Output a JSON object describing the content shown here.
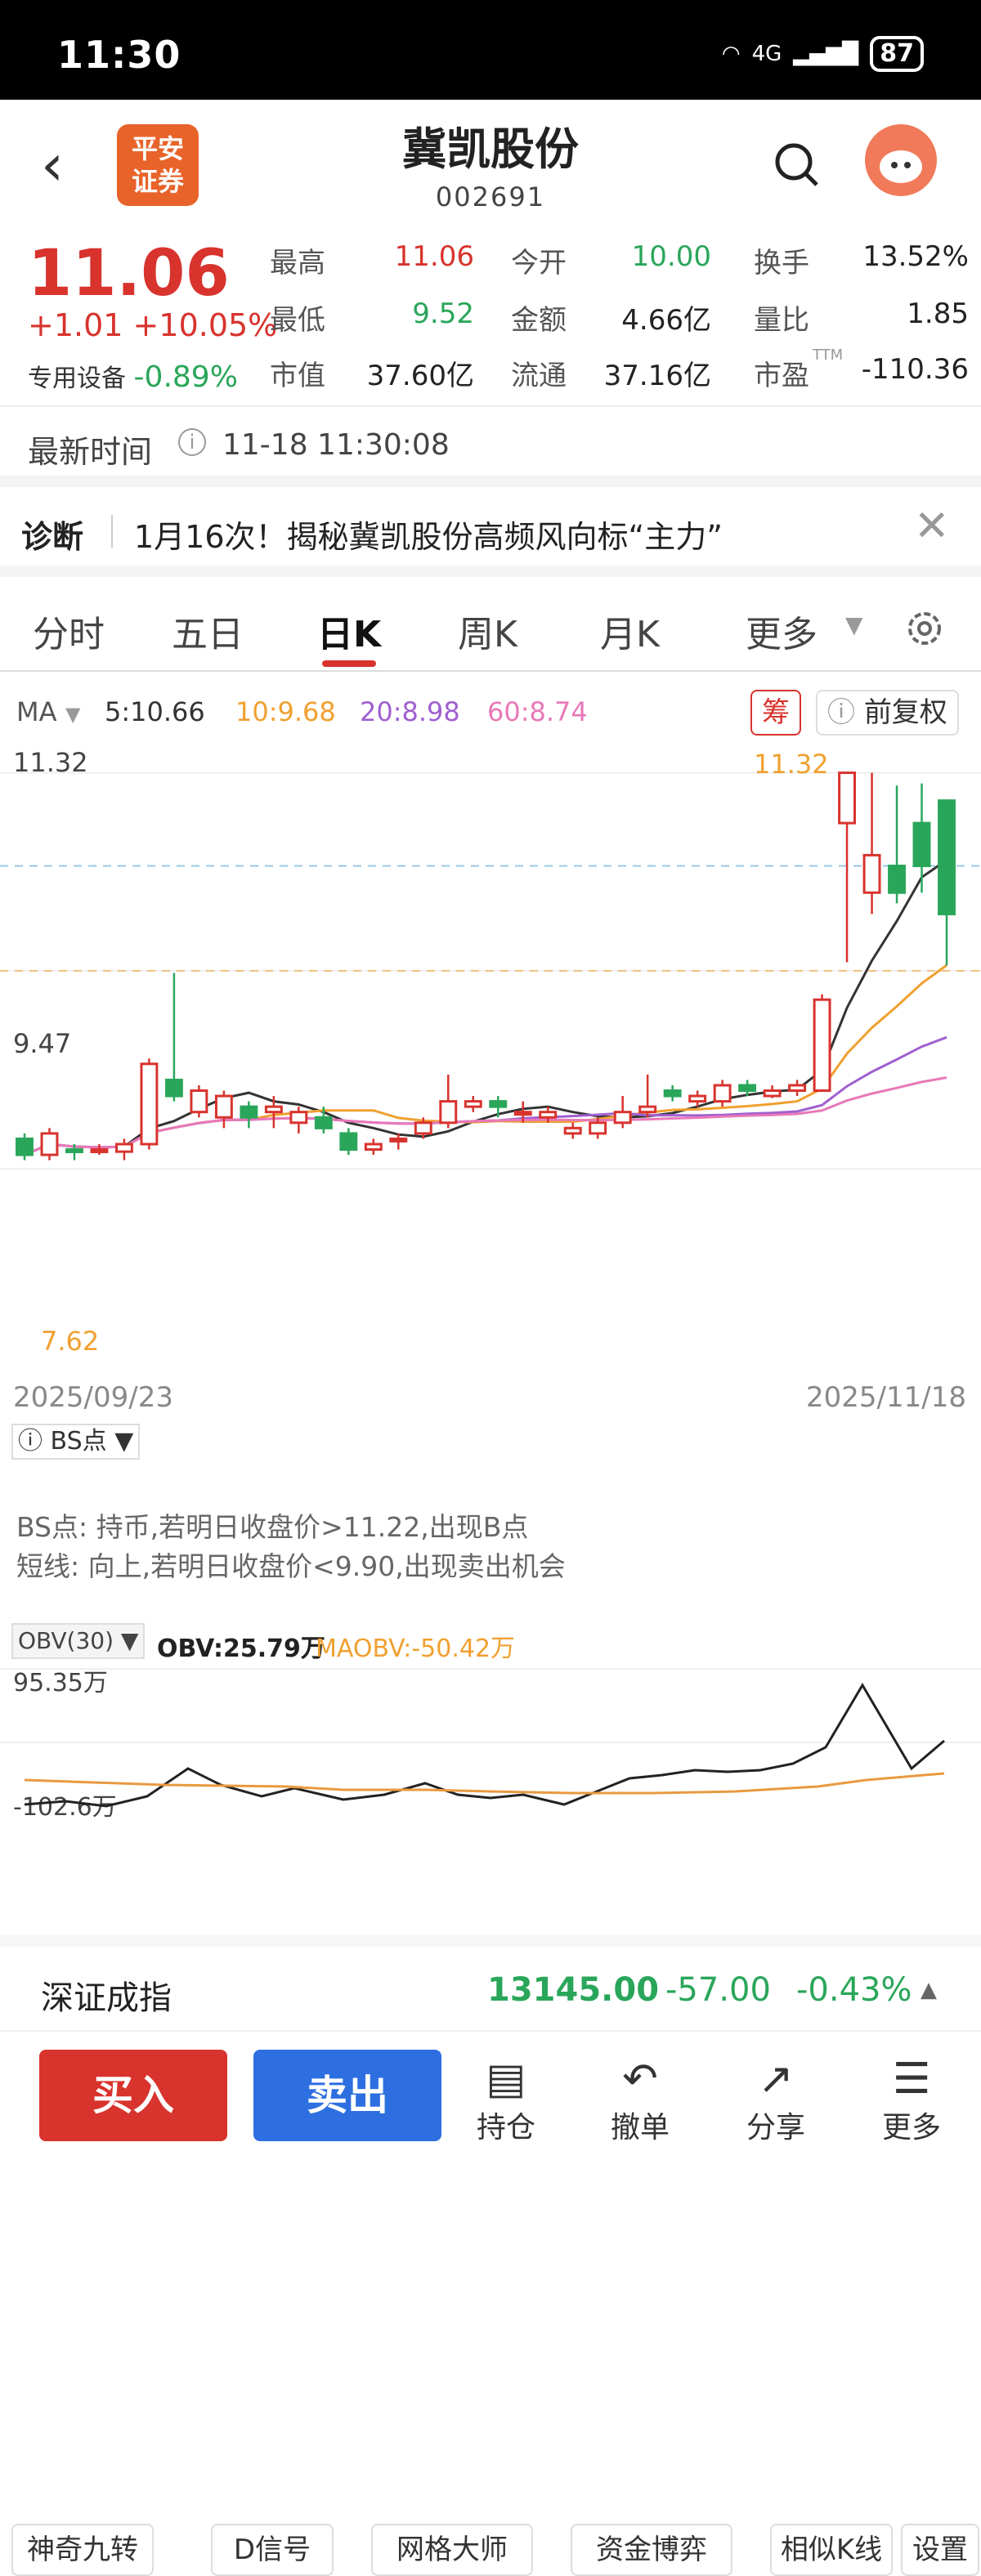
{
  "status": {
    "time": "11:30",
    "network": "4G",
    "battery": "87"
  },
  "header": {
    "back": "‹",
    "logo_line1": "平安",
    "logo_line2": "证券",
    "title": "冀凯股份",
    "code": "002691"
  },
  "quote": {
    "price": "11.06",
    "change": "+1.01",
    "change_pct": "+10.05%",
    "sector": "专用设备",
    "sector_pct": "-0.89%",
    "rows": [
      [
        {
          "l": "最高",
          "v": "11.06",
          "c": "red"
        },
        {
          "l": "今开",
          "v": "10.00",
          "c": "green"
        },
        {
          "l": "换手",
          "v": "13.52%",
          "c": "dark"
        }
      ],
      [
        {
          "l": "最低",
          "v": "9.52",
          "c": "green"
        },
        {
          "l": "金额",
          "v": "4.66亿",
          "c": "dark"
        },
        {
          "l": "量比",
          "v": "1.85",
          "c": "dark"
        }
      ],
      [
        {
          "l": "市值",
          "v": "37.60亿",
          "c": "dark"
        },
        {
          "l": "流通",
          "v": "37.16亿",
          "c": "dark"
        },
        {
          "l": "市盈",
          "v": "-110.36",
          "c": "dark",
          "sup": "TTM"
        }
      ]
    ]
  },
  "latest": {
    "label": "最新时间",
    "value": "11-18 11:30:08"
  },
  "diagnosis": {
    "label": "诊断",
    "text": "1月16次！揭秘冀凯股份高频风向标“主力”"
  },
  "tabs": [
    "分时",
    "五日",
    "日K",
    "周K",
    "月K",
    "更多"
  ],
  "ma": {
    "label": "MA",
    "ma5": "5:10.66",
    "ma10": "10:9.68",
    "ma20": "20:8.98",
    "ma60": "60:8.74",
    "chou": "筹",
    "fuquan": "前复权"
  },
  "chart_data": {
    "type": "candlestick",
    "start_date": "2025/09/23",
    "end_date": "2025/11/18",
    "high_label": "11.32",
    "ref_label": "9.47",
    "low_label": "7.62",
    "ylim": [
      7.3,
      11.5
    ],
    "candles": [
      [
        7.9,
        7.75,
        7.95,
        7.7
      ],
      [
        7.75,
        7.95,
        8.0,
        7.7
      ],
      [
        7.8,
        7.78,
        7.85,
        7.7
      ],
      [
        7.8,
        7.8,
        7.85,
        7.75
      ],
      [
        7.78,
        7.85,
        7.9,
        7.7
      ],
      [
        7.85,
        8.6,
        8.65,
        7.8
      ],
      [
        8.45,
        8.3,
        9.45,
        8.25
      ],
      [
        8.15,
        8.35,
        8.4,
        8.1
      ],
      [
        8.1,
        8.3,
        8.35,
        8.0
      ],
      [
        8.2,
        8.1,
        8.25,
        8.0
      ],
      [
        8.15,
        8.2,
        8.3,
        8.0
      ],
      [
        8.05,
        8.15,
        8.2,
        7.95
      ],
      [
        8.1,
        8.0,
        8.2,
        7.95
      ],
      [
        7.95,
        7.8,
        8.0,
        7.75
      ],
      [
        7.8,
        7.85,
        7.9,
        7.75
      ],
      [
        7.9,
        7.9,
        7.95,
        7.8
      ],
      [
        7.95,
        8.05,
        8.1,
        7.9
      ],
      [
        8.05,
        8.25,
        8.5,
        8.0
      ],
      [
        8.2,
        8.25,
        8.3,
        8.15
      ],
      [
        8.25,
        8.2,
        8.3,
        8.1
      ],
      [
        8.15,
        8.15,
        8.25,
        8.05
      ],
      [
        8.1,
        8.15,
        8.2,
        8.05
      ],
      [
        7.95,
        8.0,
        8.05,
        7.9
      ],
      [
        7.95,
        8.05,
        8.1,
        7.9
      ],
      [
        8.05,
        8.15,
        8.3,
        8.0
      ],
      [
        8.15,
        8.2,
        8.5,
        8.1
      ],
      [
        8.35,
        8.3,
        8.4,
        8.25
      ],
      [
        8.25,
        8.3,
        8.35,
        8.2
      ],
      [
        8.25,
        8.4,
        8.45,
        8.2
      ],
      [
        8.4,
        8.35,
        8.45,
        8.3
      ],
      [
        8.3,
        8.35,
        8.4,
        8.28
      ],
      [
        8.35,
        8.4,
        8.45,
        8.3
      ],
      [
        8.35,
        9.2,
        9.25,
        8.35
      ],
      [
        10.85,
        11.32,
        11.32,
        9.55
      ],
      [
        10.2,
        10.55,
        11.32,
        10.0
      ],
      [
        10.45,
        10.2,
        11.2,
        10.1
      ],
      [
        10.85,
        10.45,
        11.22,
        10.2
      ],
      [
        11.06,
        10.0,
        11.06,
        9.52
      ]
    ]
  },
  "bs": {
    "label": "BS点",
    "line1": "BS点: 持币,若明日收盘价>11.22,出现B点",
    "line2": "短线: 向上,若明日收盘价<9.90,出现卖出机会"
  },
  "obv": {
    "label": "OBV(30)",
    "obv": "OBV:25.79万",
    "maobv": "MAOBV:-50.42万",
    "top": "95.35万",
    "bottom": "-102.6万"
  },
  "tools": [
    "神奇九转",
    "D信号",
    "网格大师",
    "资金博弈",
    "相似K线",
    "设置"
  ],
  "index": {
    "name": "深证成指",
    "value": "13145.00",
    "change": "-57.00",
    "pct": "-0.43%"
  },
  "bottom": {
    "buy": "买入",
    "sell": "卖出",
    "hold": "持仓",
    "cancel": "撤单",
    "share": "分享",
    "more": "更多"
  },
  "colors": {
    "up": "#d8332d",
    "down": "#2aa65a",
    "ma5": "#333333",
    "ma10": "#f0a030",
    "ma20": "#a060d0",
    "ma60": "#e878b8"
  }
}
